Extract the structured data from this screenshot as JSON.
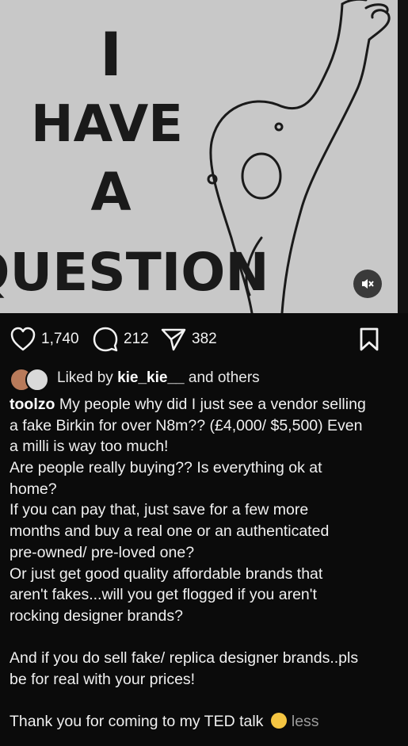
{
  "post": {
    "image_text": [
      "I",
      "HAVE",
      "A",
      "QUESTION"
    ],
    "mute_icon": "speaker-muted-icon"
  },
  "actions": {
    "likes": "1,740",
    "comments": "212",
    "shares": "382"
  },
  "liked_by": {
    "prefix": "Liked by",
    "user": "kie_kie__",
    "suffix": "and others"
  },
  "caption": {
    "username": "toolzo",
    "first_line_rest": " My people why did I just see a vendor selling",
    "lines": [
      "a fake Birkin for over N8m?? (£4,000/ $5,500) Even",
      "a milli is way too much!",
      "Are people really buying?? Is everything ok at",
      "home?",
      "If you can pay that, just save for a few more",
      "months and buy a real one or an authenticated",
      "pre-owned/ pre-loved one?",
      "Or just get good quality affordable brands that",
      "aren't fakes...will you get flogged if you aren't",
      "rocking designer brands?",
      "",
      "And if you do sell fake/ replica designer brands..pls",
      "be for real with your prices!",
      ""
    ],
    "last_line": "Thank you for coming to my TED talk",
    "less": "less"
  }
}
